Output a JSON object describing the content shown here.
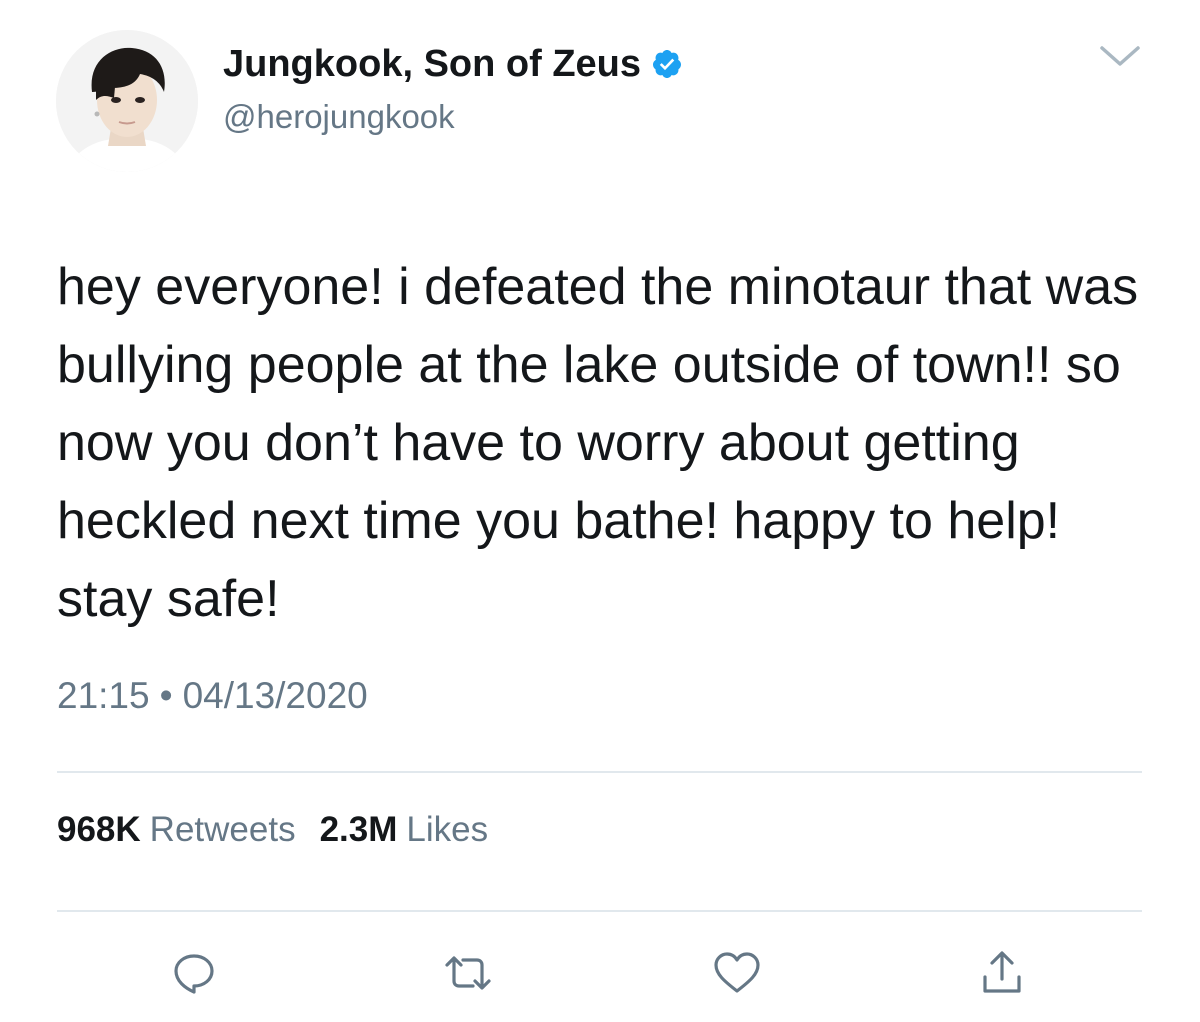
{
  "user": {
    "display_name": "Jungkook, Son of Zeus",
    "handle": "@herojungkook",
    "verified": true,
    "avatar": "profile-photo"
  },
  "tweet": {
    "text": "hey everyone! i defeated the minotaur that was bullying people at the lake outside of town!! so now you don’t have to worry about getting heckled next time you bathe! happy to help! stay safe!",
    "time": "21:15",
    "separator": "•",
    "date": "04/13/2020"
  },
  "stats": {
    "retweets_count": "968K",
    "retweets_label": "Retweets",
    "likes_count": "2.3M",
    "likes_label": "Likes"
  },
  "icons": {
    "verified": "verified-badge-icon",
    "menu": "chevron-down-icon",
    "reply": "reply-icon",
    "retweet": "retweet-icon",
    "like": "heart-icon",
    "share": "share-icon"
  },
  "colors": {
    "text": "#14171a",
    "secondary": "#657786",
    "verified": "#1da1f2",
    "divider": "#e1e8ed"
  }
}
